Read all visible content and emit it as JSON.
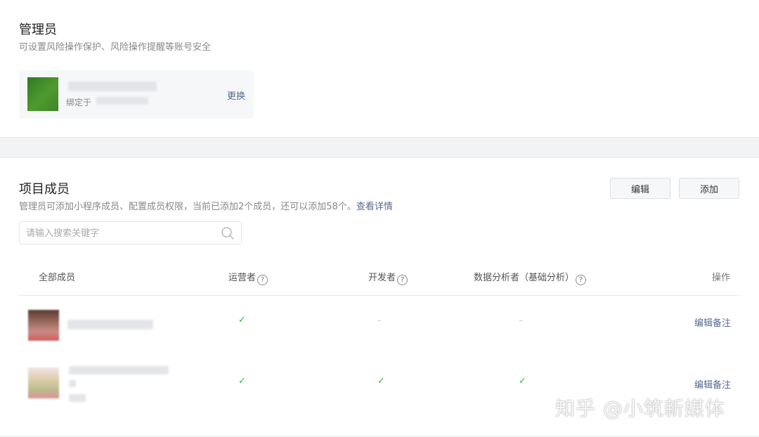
{
  "admin": {
    "title": "管理员",
    "subtitle": "可设置风险操作保护、风险操作提醒等账号安全",
    "bound_label": "绑定于",
    "change_link": "更换"
  },
  "members": {
    "title": "项目成员",
    "desc_text": "管理员可添加小程序成员、配置成员权限，当前已添加2个成员，还可以添加58个。",
    "detail_link": "查看详情",
    "edit_button": "编辑",
    "add_button": "添加",
    "search_placeholder": "请输入搜索关键字",
    "columns": {
      "all": "全部成员",
      "operator": "运营者",
      "developer": "开发者",
      "analyst": "数据分析者（基础分析）",
      "actions": "操作"
    },
    "rows": [
      {
        "operator": "✓",
        "developer": "–",
        "analyst": "–",
        "action": "编辑备注"
      },
      {
        "operator": "✓",
        "developer": "✓",
        "analyst": "✓",
        "action": "编辑备注"
      }
    ]
  },
  "watermark": "知乎 @小筑新媒体",
  "colors": {
    "link": "#576b95",
    "check": "#34b349",
    "background": "#f2f3f5"
  },
  "icons": {
    "search": "search-icon",
    "help": "help-circle-icon"
  }
}
